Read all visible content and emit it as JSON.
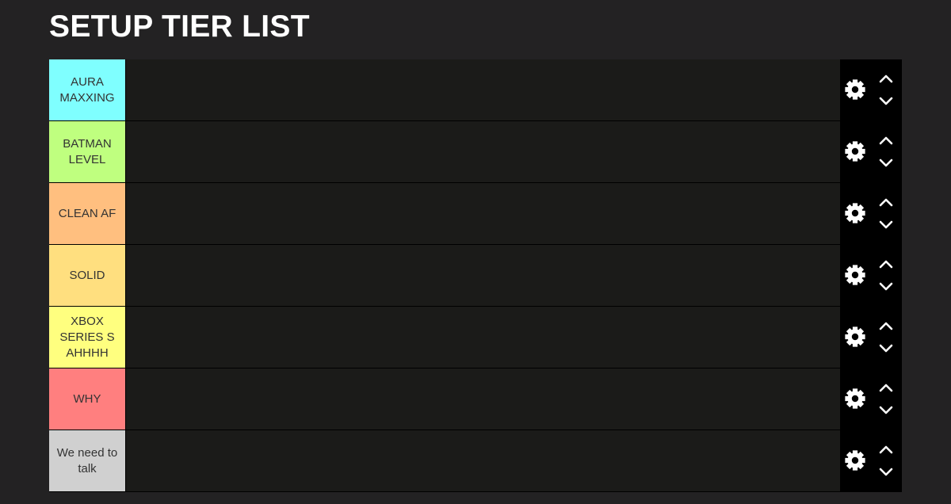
{
  "page": {
    "title": "SETUP TIER LIST"
  },
  "tiers": [
    {
      "label": "AURA MAXXING",
      "color": "#7fffff"
    },
    {
      "label": "BATMAN LEVEL",
      "color": "#bfff7f"
    },
    {
      "label": "CLEAN AF",
      "color": "#ffbf7f"
    },
    {
      "label": "SOLID",
      "color": "#ffdf7f"
    },
    {
      "label": "XBOX SERIES S AHHHH",
      "color": "#ffff7f"
    },
    {
      "label": "WHY",
      "color": "#ff7f7f"
    },
    {
      "label": "We need to talk",
      "color": "#d0d0d0"
    }
  ],
  "icons": {
    "settings": "gear-icon",
    "move_up": "chevron-up-icon",
    "move_down": "chevron-down-icon"
  },
  "colors": {
    "page_background": "#232223",
    "row_background": "#1b1b19",
    "controls_background": "#000000",
    "title_color": "#ffffff"
  }
}
